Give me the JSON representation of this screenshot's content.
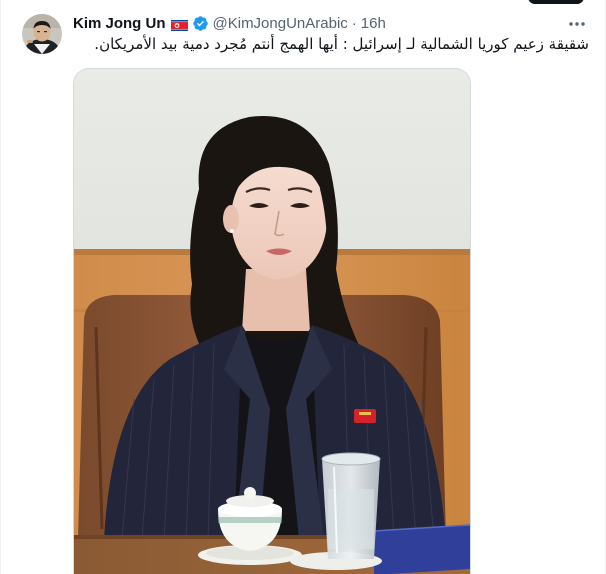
{
  "tweet": {
    "display_name": "Kim Jong Un",
    "handle": "@KimJongUnArabic",
    "separator": "·",
    "time": "16h",
    "text": "شقيقة زعيم كوريا الشمالية لـ إسرائيل : أيها الهمج أنتم مُجرد دمية بيد الأمريكان.",
    "flag_icon": "north-korea-flag-icon",
    "verified_icon": "verified-badge-icon",
    "more_icon": "more-options-icon"
  },
  "colors": {
    "text_primary": "#0f1419",
    "text_secondary": "#536471",
    "verified_blue": "#1d9bf0",
    "border": "#cfd9de"
  }
}
